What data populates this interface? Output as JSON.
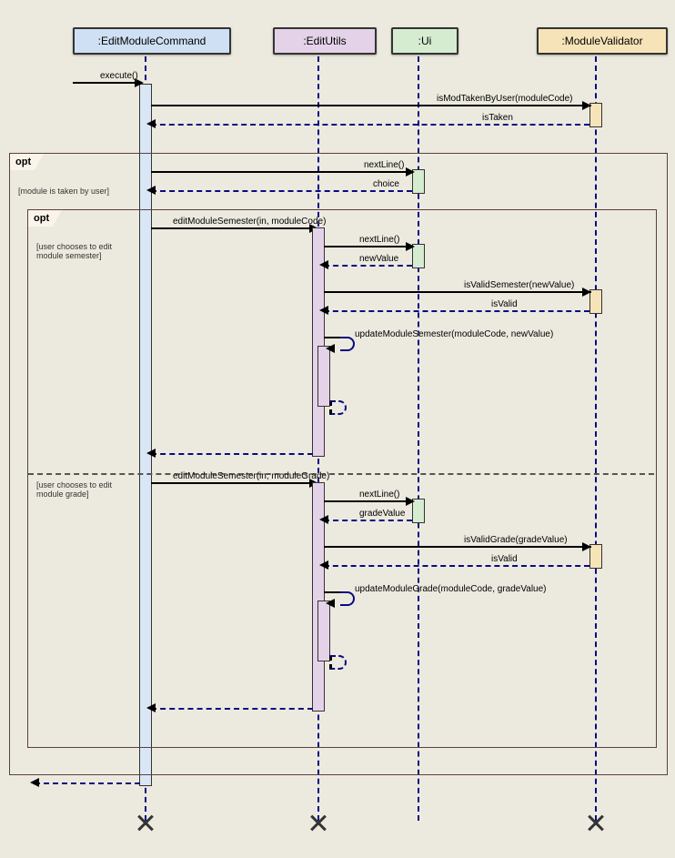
{
  "lifelines": {
    "edit_cmd": ":EditModuleCommand",
    "edit_utils": ":EditUtils",
    "ui": ":Ui",
    "validator": ":ModuleValidator"
  },
  "fragments": {
    "outer_opt": "opt",
    "outer_guard": "[module is taken by user]",
    "inner_opt": "opt",
    "inner_guard1": "[user chooses to edit module semester]",
    "inner_guard2": "[user chooses to edit module grade]"
  },
  "messages": {
    "execute": "execute()",
    "isModTaken": "isModTakenByUser(moduleCode)",
    "isTaken": "isTaken",
    "nextLine1": "nextLine()",
    "choice": "choice",
    "editSem": "editModuleSemester(in, moduleCode)",
    "nextLine2": "nextLine()",
    "newValue": "newValue",
    "isValidSem": "isValidSemester(newValue)",
    "isValid1": "isValid",
    "updateSem": "updateModuleSemester(moduleCode, newValue)",
    "editGrade": "editModuleSemester(in, moduleGrade)",
    "nextLine3": "nextLine()",
    "gradeValue": "gradeValue",
    "isValidGrade": "isValidGrade(gradeValue)",
    "isValid2": "isValid",
    "updateGrade": "updateModuleGrade(moduleCode, gradeValue)"
  }
}
